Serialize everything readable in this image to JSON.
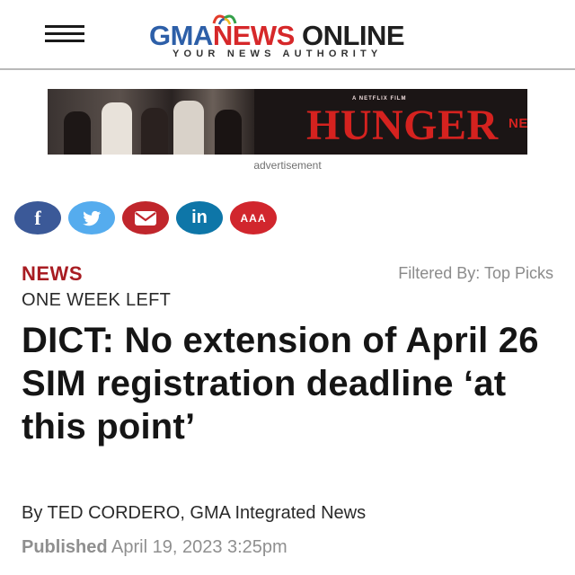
{
  "header": {
    "logo": {
      "part1": "GMA",
      "part2": "NEWS",
      "part3": "ONLINE",
      "tagline": "YOUR NEWS AUTHORITY"
    },
    "menu_icon": "hamburger-menu-icon"
  },
  "advertisement": {
    "film_label": "A NETFLIX FILM",
    "title": "HUNGER",
    "brand": "NETFLIX",
    "label": "advertisement"
  },
  "share": {
    "buttons": [
      {
        "icon": "facebook-icon",
        "glyph": "f",
        "color": "#3b5998"
      },
      {
        "icon": "twitter-icon",
        "glyph": "",
        "color": "#55acee"
      },
      {
        "icon": "email-icon",
        "glyph": "",
        "color": "#c0262c"
      },
      {
        "icon": "linkedin-icon",
        "glyph": "in",
        "color": "#0e76a8"
      },
      {
        "icon": "text-size-icon",
        "glyph": "AAA",
        "color": "#d1262d"
      }
    ]
  },
  "article": {
    "section": "NEWS",
    "filter": "Filtered By: Top Picks",
    "kicker": "ONE WEEK LEFT",
    "headline": "DICT: No extension of April 26 SIM registration deadline ‘at this point’",
    "byline": "By TED CORDERO, GMA Integrated News",
    "published_label": "Published",
    "published_date": "April 19, 2023 3:25pm"
  },
  "colors": {
    "brand_blue": "#2d5fa8",
    "brand_red": "#d6282a",
    "section_red": "#a81c22",
    "ad_red": "#d5221f"
  }
}
